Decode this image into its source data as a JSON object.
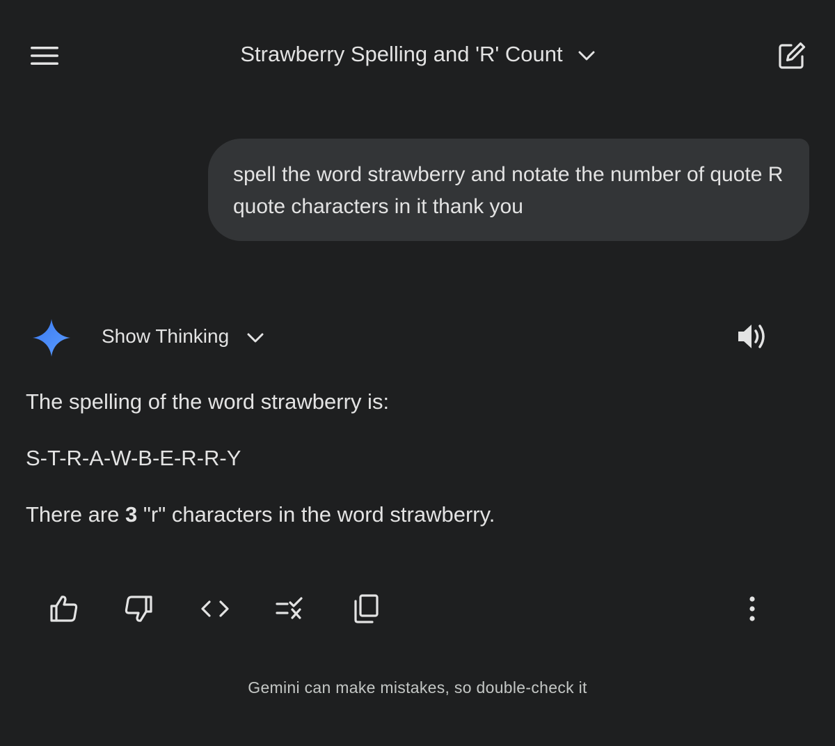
{
  "header": {
    "title": "Strawberry Spelling and 'R' Count"
  },
  "user_message": {
    "text": "spell the word strawberry and notate the number of quote R quote characters in it thank you"
  },
  "response": {
    "show_thinking_label": "Show Thinking",
    "line1": "The spelling of the word strawberry is:",
    "line2": "S-T-R-A-W-B-E-R-R-Y",
    "line3_prefix": "There are ",
    "line3_count": "3",
    "line3_suffix": " \"r\" characters in the word strawberry."
  },
  "footer": {
    "disclaimer": "Gemini can make mistakes, so double-check it"
  },
  "icons": {
    "menu": "hamburger-menu-icon",
    "title_dropdown": "chevron-down-icon",
    "new_chat": "edit-square-icon",
    "gemini": "gemini-sparkle-icon",
    "speaker": "volume-icon",
    "actions": [
      "thumb-up-icon",
      "thumb-down-icon",
      "code-icon",
      "modify-response-icon",
      "copy-icon",
      "more-vert-icon"
    ]
  },
  "colors": {
    "background": "#1e1f20",
    "bubble": "#333537",
    "text": "#e3e3e3",
    "gemini_blue": "#4285f4"
  }
}
